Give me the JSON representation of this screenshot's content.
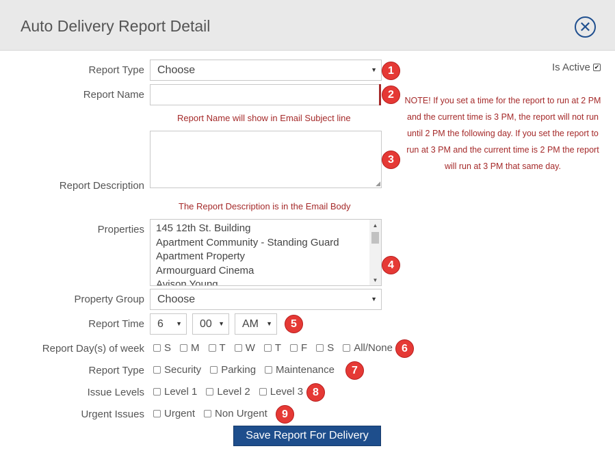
{
  "dialog": {
    "title": "Auto Delivery Report Detail",
    "close_icon": "close-circle-icon"
  },
  "is_active": {
    "label": "Is Active",
    "checked": true
  },
  "note": "NOTE! If you set a time for the report to run at 2 PM and the current time is 3 PM, the report will not run until 2 PM the following day. If you set the report to run at 3 PM and the current time is 2 PM the report will run at 3 PM that same day.",
  "fields": {
    "report_type": {
      "label": "Report Type",
      "value": "Choose"
    },
    "report_name": {
      "label": "Report Name",
      "value": "",
      "hint": "Report Name will show in Email Subject line"
    },
    "report_description": {
      "label": "Report Description",
      "value": "",
      "hint": "The Report Description is in the Email Body"
    },
    "properties": {
      "label": "Properties",
      "options": [
        "145 12th St. Building",
        "Apartment Community - Standing Guard",
        "Apartment Property",
        "Armourguard Cinema",
        "Avison Young"
      ]
    },
    "property_group": {
      "label": "Property Group",
      "value": "Choose"
    },
    "report_time": {
      "label": "Report Time",
      "hour": "6",
      "minute": "00",
      "ampm": "AM"
    },
    "report_days": {
      "label": "Report Day(s) of week",
      "options": [
        "S",
        "M",
        "T",
        "W",
        "T",
        "F",
        "S",
        "All/None"
      ]
    },
    "report_type_checks": {
      "label": "Report Type",
      "options": [
        "Security",
        "Parking",
        "Maintenance"
      ]
    },
    "issue_levels": {
      "label": "Issue Levels",
      "options": [
        "Level 1",
        "Level 2",
        "Level 3"
      ]
    },
    "urgent_issues": {
      "label": "Urgent Issues",
      "options": [
        "Urgent",
        "Non Urgent"
      ]
    }
  },
  "badges": [
    "1",
    "2",
    "3",
    "4",
    "5",
    "6",
    "7",
    "8",
    "9"
  ],
  "save_button": "Save Report For Delivery",
  "colors": {
    "header_bg": "#e9e9e9",
    "accent": "#1e4e8c",
    "hint": "#a52a2a",
    "badge": "#e53935"
  }
}
